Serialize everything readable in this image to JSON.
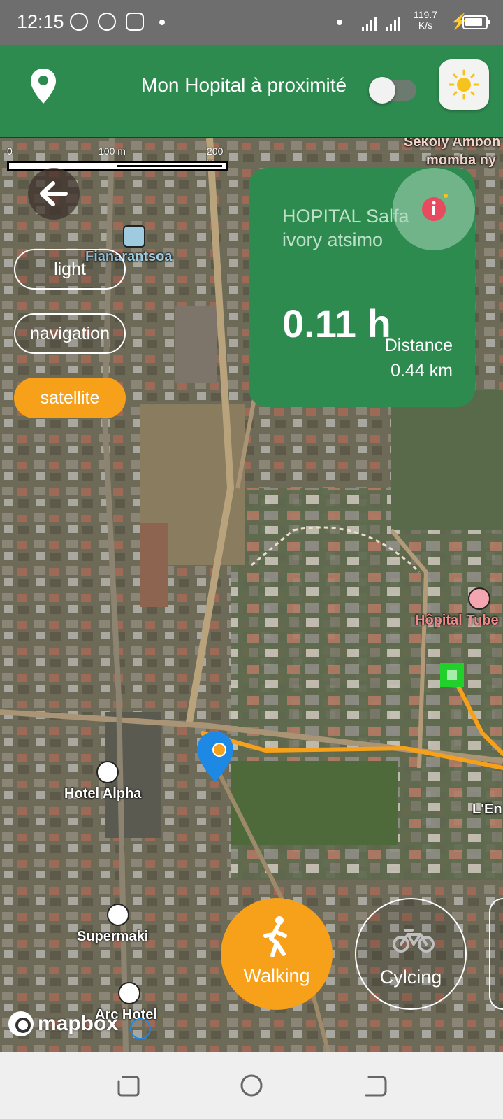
{
  "status_bar": {
    "time": "12:15",
    "speed": "119.7",
    "speed_unit": "K/s",
    "icons": [
      "messenger-icon",
      "facebook-icon",
      "instagram-icon",
      "dot",
      "signal-icon",
      "signal-icon",
      "charging-icon",
      "battery-icon"
    ]
  },
  "header": {
    "title": "Mon Hopital à proximité",
    "toggle_on": false,
    "icons": [
      "location-pin-icon",
      "sun-icon"
    ],
    "colors": {
      "bar": "#2e8b50",
      "accent": "#f7a11a"
    }
  },
  "map": {
    "scale": {
      "zero": "0",
      "mid": "100 m",
      "max": "200 m"
    },
    "style_buttons": [
      {
        "label": "light",
        "active": false
      },
      {
        "label": "navigation",
        "active": false
      },
      {
        "label": "satellite",
        "active": true
      }
    ],
    "labels": {
      "place_top_right_1": "Sekoly Ambon",
      "place_top_right_2": "momba ny",
      "station": "Fianarantsoa",
      "hospital": "Hôpital Tube",
      "hotel_alpha": "Hotel Alpha",
      "supermaki": "Supermaki",
      "arc_hotel": "Arc Hotel",
      "lem": "L'En"
    },
    "attribution": "mapbox"
  },
  "info_card": {
    "hospital_name": "HOPITAL Salfa ivory atsimo",
    "duration": "0.11 h",
    "distance_label": "Distance",
    "distance_value": "0.44 km"
  },
  "travel_modes": [
    {
      "label": "Walking",
      "icon": "walking-icon",
      "active": true
    },
    {
      "label": "Cylcing",
      "icon": "bicycle-icon",
      "active": false
    }
  ],
  "nav_bar": {
    "buttons": [
      "recent-apps",
      "home",
      "back"
    ]
  }
}
